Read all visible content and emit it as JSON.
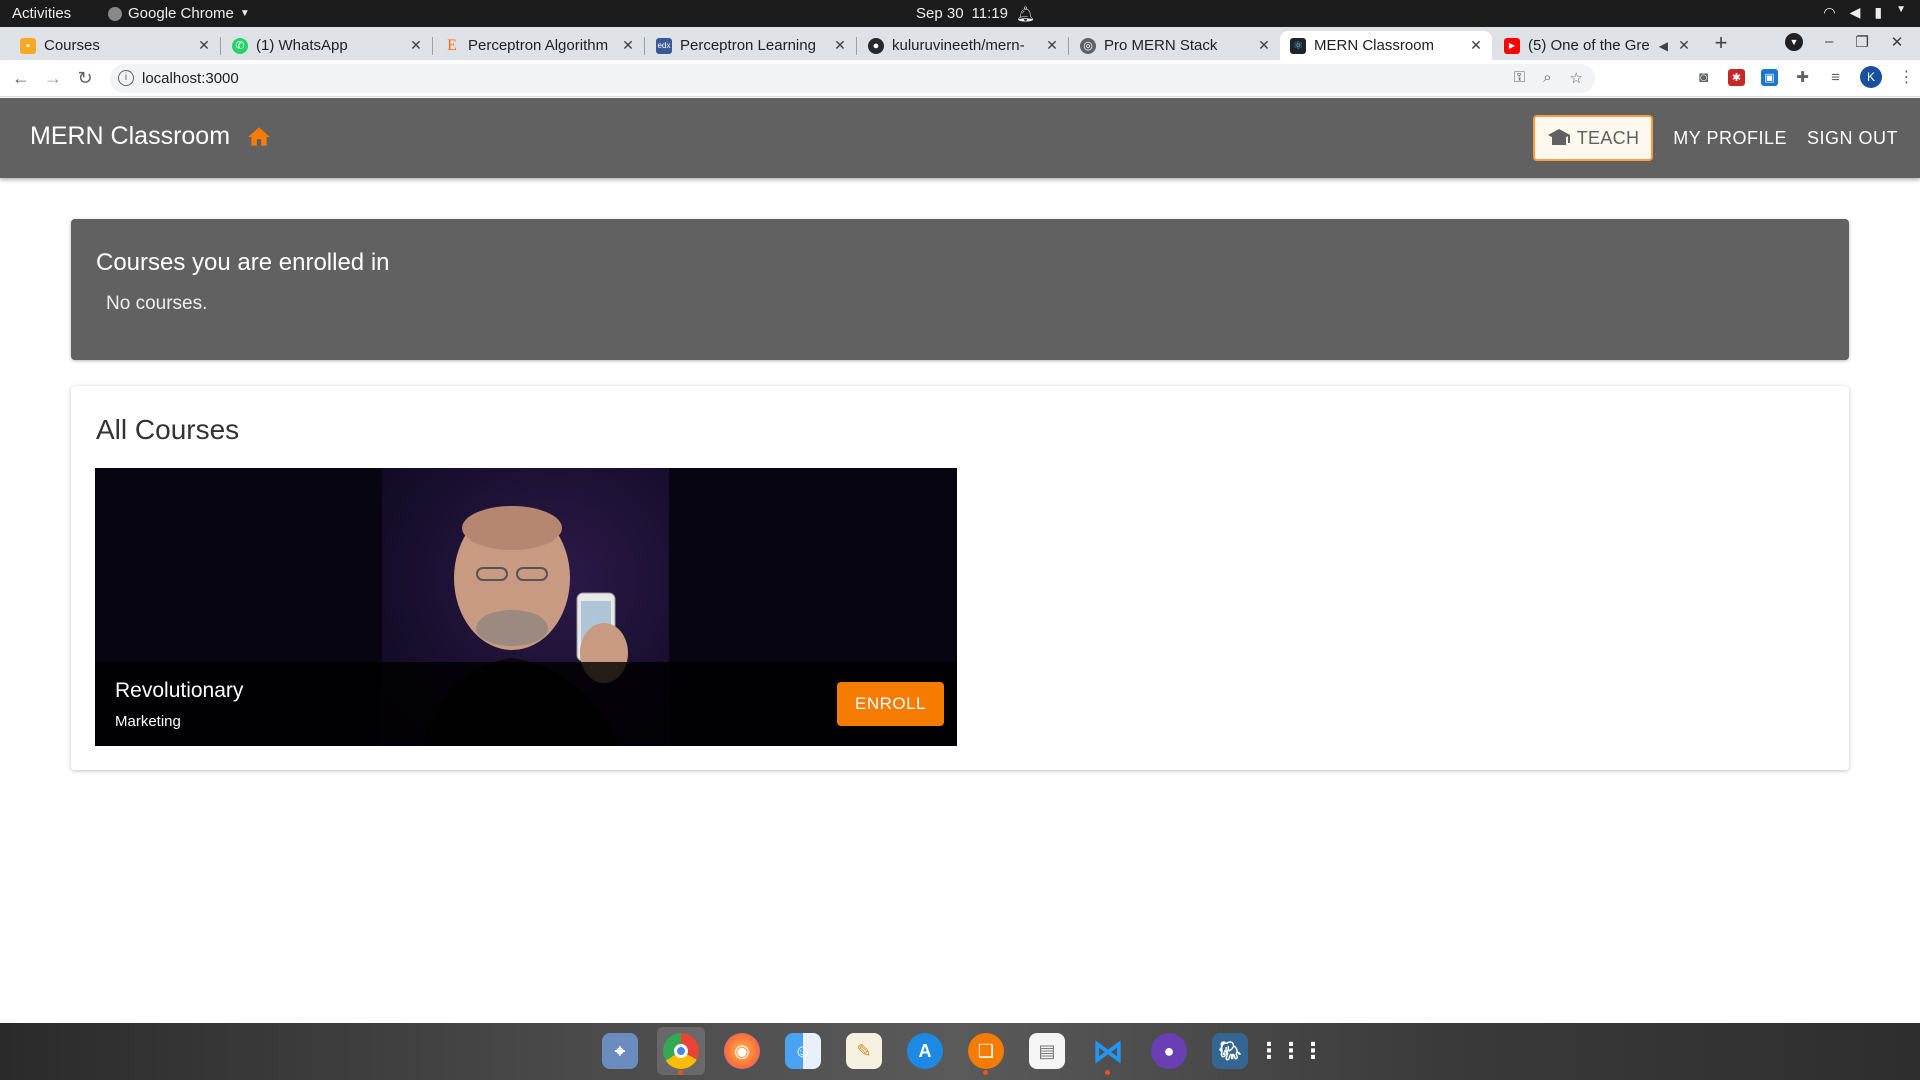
{
  "system": {
    "activities": "Activities",
    "app_name": "Google Chrome",
    "date": "Sep 30",
    "time": "11:19"
  },
  "browser": {
    "tabs": [
      {
        "title": "Courses",
        "favicon": "courses-favicon",
        "color": "#f9a825"
      },
      {
        "title": "(1) WhatsApp",
        "favicon": "whatsapp-favicon",
        "color": "#25d366"
      },
      {
        "title": "Perceptron Algorithm",
        "favicon": "e-favicon",
        "color": "#ff6d00"
      },
      {
        "title": "Perceptron Learning",
        "favicon": "edx-favicon",
        "color": "#3b5998"
      },
      {
        "title": "kuluruvineeth/mern-",
        "favicon": "github-favicon",
        "color": "#24292e"
      },
      {
        "title": "Pro MERN Stack",
        "favicon": "globe-favicon",
        "color": "#5f6368"
      },
      {
        "title": "MERN Classroom",
        "favicon": "react-favicon",
        "color": "#20232a"
      },
      {
        "title": "(5) One of the Gre",
        "favicon": "youtube-favicon",
        "color": "#ff0000"
      }
    ],
    "url": "localhost:3000",
    "profile_initial": "K"
  },
  "appbar": {
    "title": "MERN Classroom",
    "teach_label": "TEACH",
    "profile_label": "MY PROFILE",
    "signout_label": "SIGN OUT",
    "accent": "#f57c00",
    "bar_color": "#616161"
  },
  "enrolled": {
    "heading": "Courses you are enrolled in",
    "empty_text": "No courses."
  },
  "all_courses": {
    "heading": "All Courses",
    "items": [
      {
        "title": "Revolutionary",
        "category": "Marketing",
        "action": "ENROLL"
      }
    ]
  },
  "dock": {
    "apps": [
      "screenshot-tool",
      "chrome",
      "firefox",
      "finder",
      "notes",
      "app-store",
      "books",
      "text-editor",
      "vscode",
      "github-desktop",
      "postgres",
      "app-grid"
    ]
  }
}
